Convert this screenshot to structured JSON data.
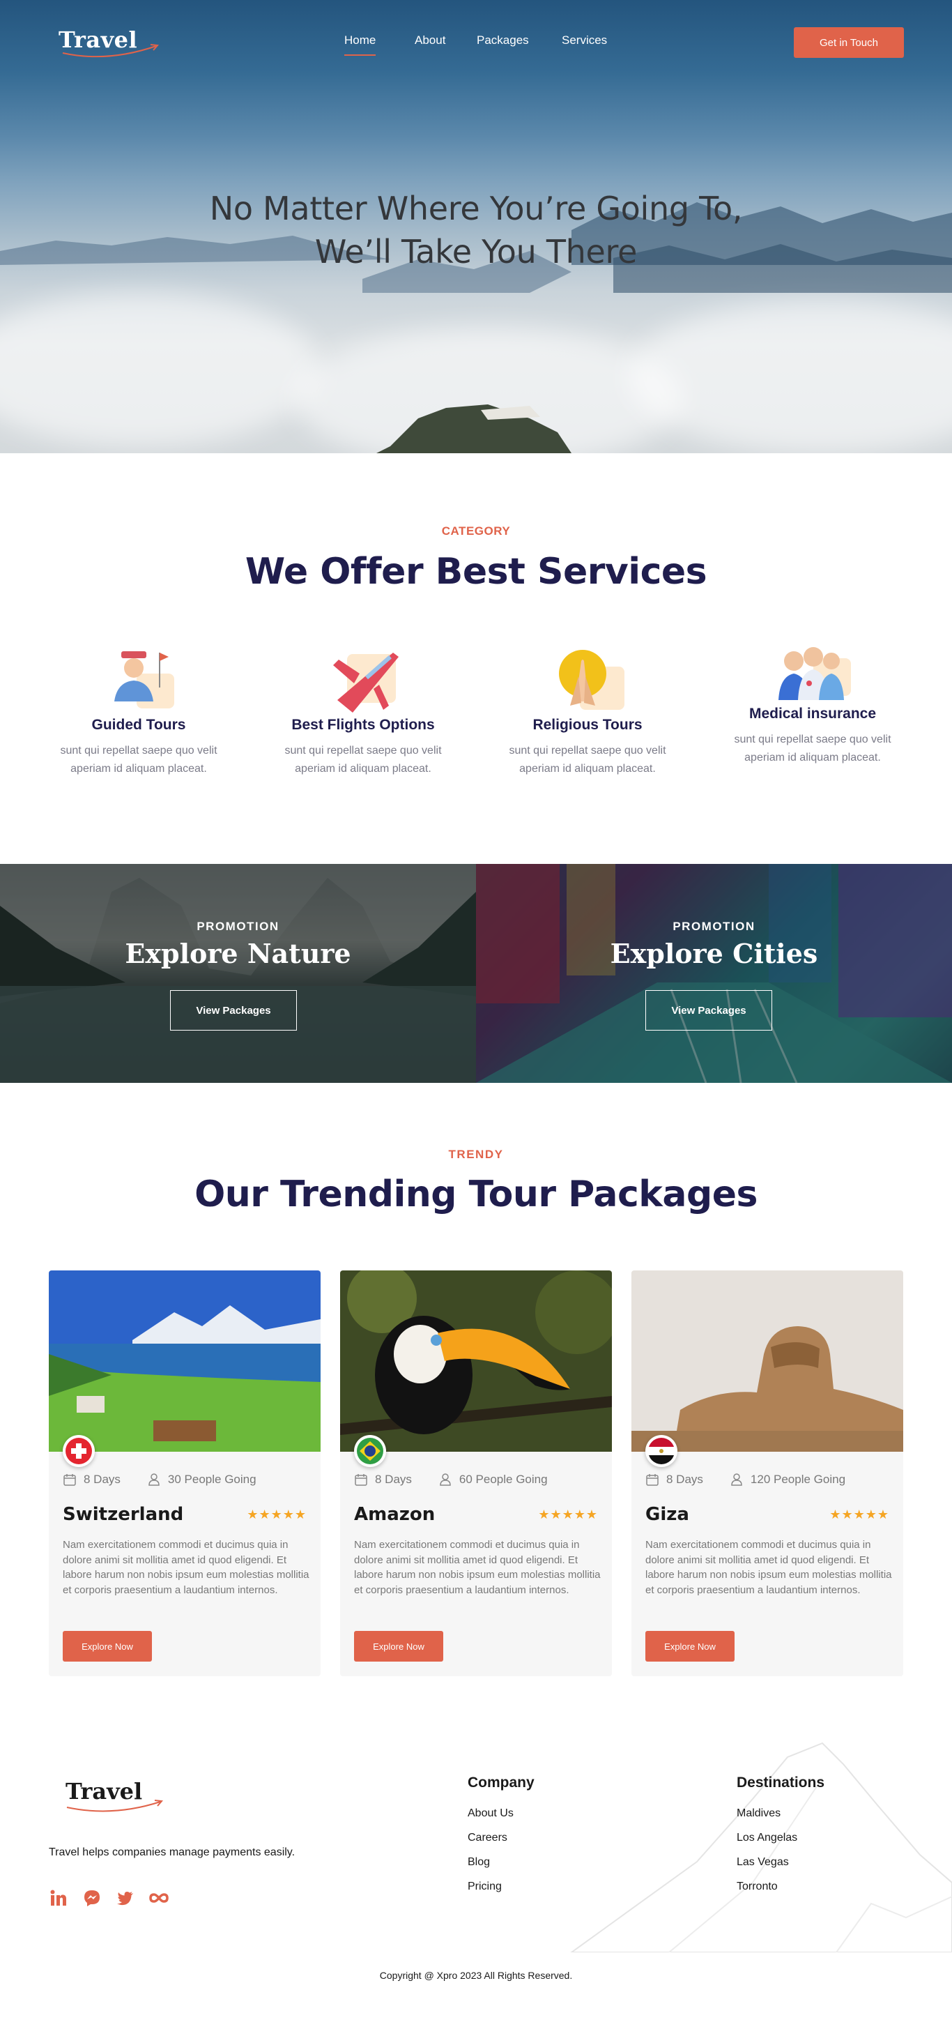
{
  "header": {
    "logo": "Travel",
    "nav": [
      {
        "label": "Home",
        "active": true
      },
      {
        "label": "About",
        "active": false
      },
      {
        "label": "Packages",
        "active": false
      },
      {
        "label": "Services",
        "active": false
      }
    ],
    "cta_label": "Get in Touch"
  },
  "hero": {
    "title_line1": "No Matter Where You’re Going To,",
    "title_line2": "We’ll Take You There"
  },
  "services": {
    "tag": "CATEGORY",
    "title": "We Offer Best Services",
    "items": [
      {
        "title": "Guided Tours",
        "text": "sunt qui repellat saepe quo velit aperiam id aliquam placeat.",
        "icon": "guide-person-icon"
      },
      {
        "title": "Best Flights Options",
        "text": "sunt qui repellat saepe quo velit aperiam id aliquam placeat.",
        "icon": "airplane-icon"
      },
      {
        "title": "Religious Tours",
        "text": "sunt qui repellat saepe quo velit aperiam id aliquam placeat.",
        "icon": "praying-hands-icon"
      },
      {
        "title": "Medical insurance",
        "text": "sunt qui repellat saepe quo velit aperiam id aliquam placeat.",
        "icon": "medical-staff-icon"
      }
    ]
  },
  "promotions": [
    {
      "tag": "PROMOTION",
      "title": "Explore Nature",
      "button": "View Packages"
    },
    {
      "tag": "PROMOTION",
      "title": "Explore Cities",
      "button": "View Packages"
    }
  ],
  "packages": {
    "tag": "TRENDY",
    "title": "Our Trending Tour Packages",
    "cards": [
      {
        "name": "Switzerland",
        "days": "8 Days",
        "people": "30 People Going",
        "rating": 5,
        "stars": "★★★★★",
        "text": "Nam exercitationem commodi et ducimus quia in dolore animi sit mollitia amet id quod eligendi. Et labore harum non nobis ipsum eum molestias mollitia et corporis praesentium a laudantium internos.",
        "button": "Explore Now",
        "flag": "switzerland-flag-icon"
      },
      {
        "name": "Amazon",
        "days": "8 Days",
        "people": "60 People Going",
        "rating": 5,
        "stars": "★★★★★",
        "text": "Nam exercitationem commodi et ducimus quia in dolore animi sit mollitia amet id quod eligendi. Et labore harum non nobis ipsum eum molestias mollitia et corporis praesentium a laudantium internos.",
        "button": "Explore Now",
        "flag": "brazil-flag-icon"
      },
      {
        "name": "Giza",
        "days": "8 Days",
        "people": "120 People Going",
        "rating": 5,
        "stars": "★★★★★",
        "text": "Nam exercitationem commodi et ducimus quia in dolore animi sit mollitia amet id quod eligendi. Et labore harum non nobis ipsum eum molestias mollitia et corporis praesentium a laudantium internos.",
        "button": "Explore Now",
        "flag": "egypt-flag-icon"
      }
    ]
  },
  "footer": {
    "logo": "Travel",
    "description": "Travel helps companies manage payments easily.",
    "socials": [
      "linkedin-icon",
      "messenger-icon",
      "twitter-icon",
      "infinity-icon"
    ],
    "company": {
      "title": "Company",
      "links": [
        "About Us",
        "Careers",
        "Blog",
        "Pricing"
      ]
    },
    "destinations": {
      "title": "Destinations",
      "links": [
        "Maldives",
        "Los Angelas",
        "Las Vegas",
        "Torronto"
      ]
    },
    "copyright": "Copyright @ Xpro 2023 All Rights Reserved."
  },
  "colors": {
    "accent": "#e0634a",
    "heading": "#1f1d4d",
    "star": "#f5a524",
    "card_bg": "#f6f6f6"
  }
}
